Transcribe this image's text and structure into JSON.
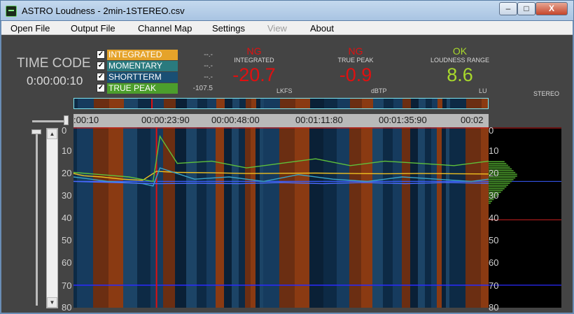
{
  "window": {
    "title": "ASTRO Loudness - 2min-1STEREO.csv"
  },
  "controls": {
    "minimize": "–",
    "maximize": "□",
    "close": "X"
  },
  "menu": [
    {
      "label": "Open File",
      "enabled": true
    },
    {
      "label": "Output File",
      "enabled": true
    },
    {
      "label": "Channel Map",
      "enabled": true
    },
    {
      "label": "Settings",
      "enabled": true
    },
    {
      "label": "View",
      "enabled": false
    },
    {
      "label": "About",
      "enabled": true
    }
  ],
  "timecode": {
    "label": "TIME CODE",
    "value": "0:00:00:10"
  },
  "legend": [
    {
      "label": "INTEGRATED",
      "value": "--.-",
      "color": "#e5a32a",
      "checked": true
    },
    {
      "label": "MOMENTARY",
      "value": "--.-",
      "color": "#2a7a7e",
      "checked": true
    },
    {
      "label": "SHORTTERM",
      "value": "--.-",
      "color": "#1a4f74",
      "checked": true
    },
    {
      "label": "TRUE PEAK",
      "value": "-107.5",
      "color": "#4c9e2c",
      "checked": true
    }
  ],
  "meters": [
    {
      "status": "NG",
      "name": "INTEGRATED",
      "value": "-20.7",
      "unit": "LKFS",
      "color": "#e01010"
    },
    {
      "status": "NG",
      "name": "TRUE PEAK",
      "value": "-0.9",
      "unit": "dBTP",
      "color": "#e01010"
    },
    {
      "status": "OK",
      "name": "LOUDNESS RANGE",
      "value": "8.6",
      "unit": "LU",
      "color": "#a8d82c"
    }
  ],
  "channel": {
    "label": "STEREO"
  },
  "time_ruler": {
    "labels": [
      ":00:10",
      "00:00:23:90",
      "00:00:48:00",
      "00:01:11:80",
      "00:01:35:90",
      "00:02"
    ]
  },
  "y_axis": {
    "labels": [
      "0",
      "10",
      "20",
      "30",
      "40",
      "50",
      "60",
      "70",
      "80"
    ]
  },
  "reference_lines": {
    "target": -24,
    "gate": -70,
    "top": 0,
    "hist_marker": -41
  },
  "colors": {
    "window_bg": "#444444",
    "plot_bg": "#000000",
    "overview_border": "#7fe6f0"
  },
  "chart_data": {
    "type": "line",
    "ylim": [
      -80,
      0
    ],
    "x_range_sec": [
      0,
      120
    ],
    "series": [
      {
        "x": [
          0,
          3,
          8,
          14,
          20,
          24,
          30,
          40,
          50,
          60,
          70,
          80,
          90,
          100,
          110,
          120
        ],
        "y": [
          -20.5,
          -21.5,
          -22,
          -23,
          -23.5,
          -19.5,
          -20,
          -20.2,
          -20.5,
          -20.4,
          -20.3,
          -20.5,
          -20.6,
          -20.5,
          -20.6,
          -20.7
        ]
      },
      {
        "x": [
          0,
          8,
          16,
          23,
          25,
          30,
          40,
          50,
          60,
          70,
          80,
          90,
          100,
          110,
          120
        ],
        "y": [
          -20,
          -21,
          -22,
          -24,
          -4,
          -16,
          -15,
          -18,
          -16,
          -14,
          -17,
          -15,
          -16,
          -17,
          -15
        ]
      },
      {
        "x": [
          0,
          10,
          20,
          23,
          25,
          35,
          45,
          55,
          65,
          75,
          85,
          95,
          105,
          115,
          120
        ],
        "y": [
          -22,
          -24,
          -25,
          -26,
          -18,
          -23,
          -22,
          -24,
          -21,
          -23,
          -24,
          -22,
          -23,
          -24,
          -23
        ]
      },
      {
        "x": [
          0,
          12,
          24,
          36,
          48,
          60,
          72,
          84,
          96,
          108,
          120
        ],
        "y": [
          -24,
          -24.5,
          -25,
          -24.8,
          -25,
          -24.5,
          -25,
          -24.5,
          -25,
          -24.5,
          -24.8
        ]
      }
    ]
  }
}
